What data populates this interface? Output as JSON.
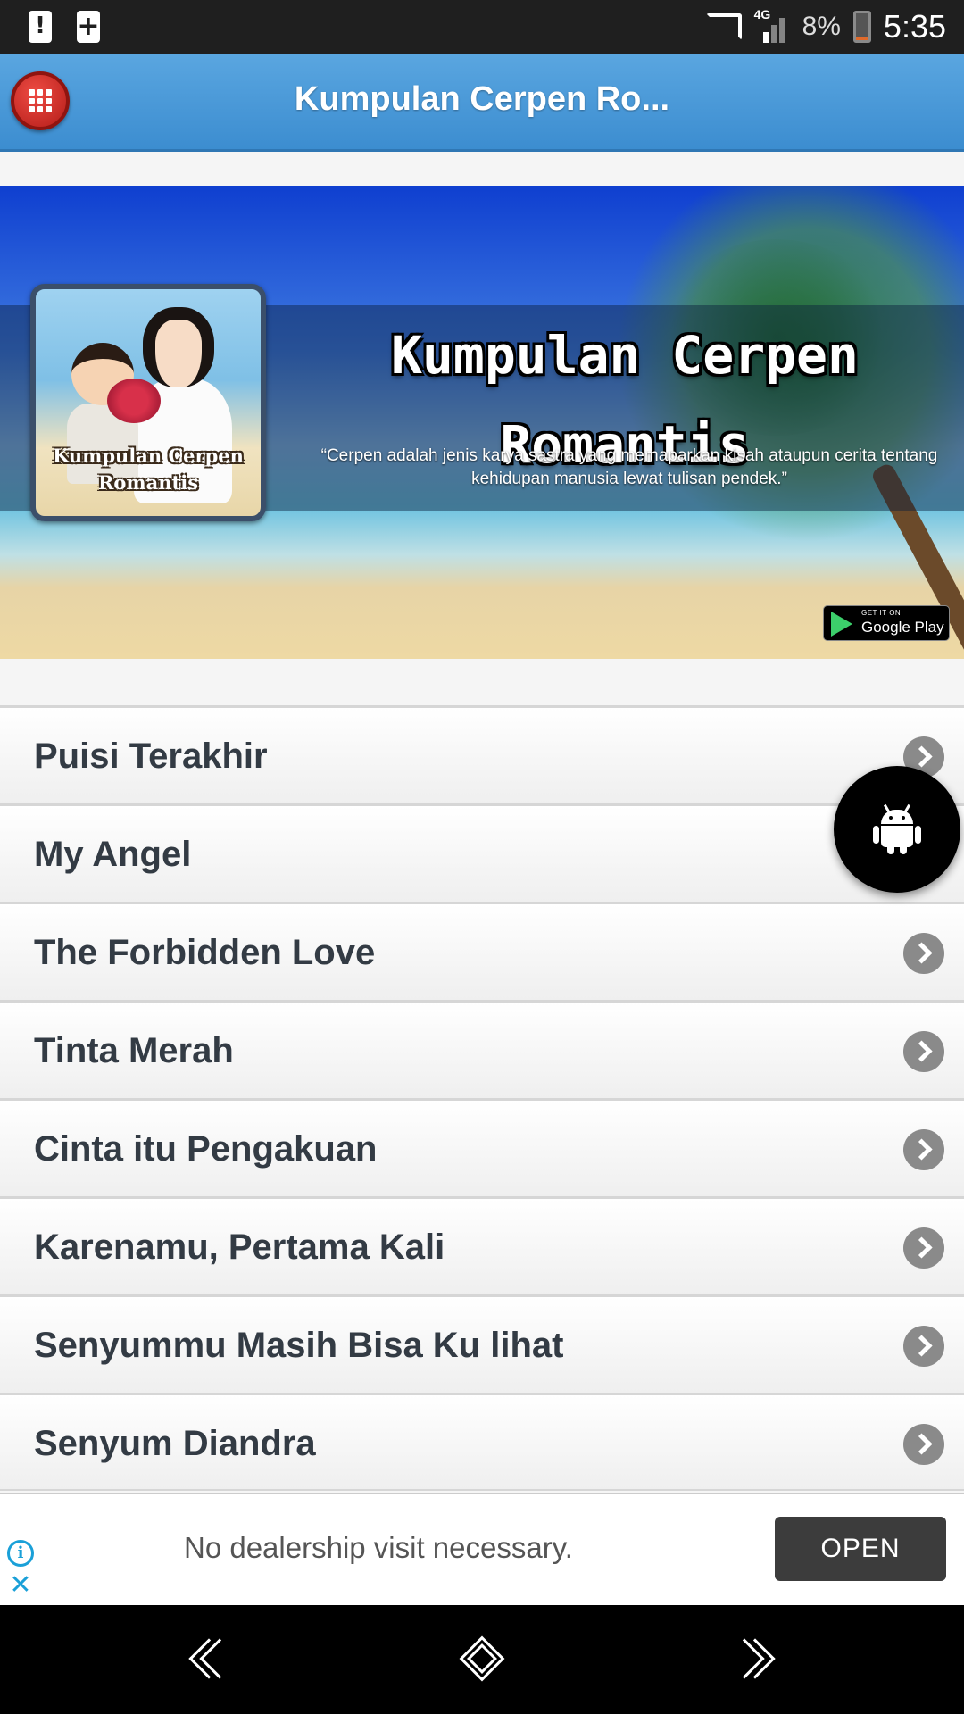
{
  "status_bar": {
    "battery_percent": "8%",
    "battery_level": 0.08,
    "network_label": "4G",
    "time": "5:35",
    "icons": [
      "alert-icon",
      "add-notification-icon",
      "cast-icon",
      "signal-icon",
      "battery-icon"
    ]
  },
  "app_bar": {
    "title": "Kumpulan Cerpen Ro...",
    "menu_icon": "grid-menu-icon",
    "accent_color": "#3c8dd0",
    "menu_button_color": "#d32f2f"
  },
  "banner": {
    "thumbnail_text": "Kumpulan Cerpen Romantis",
    "title_line1": "Kumpulan Cerpen",
    "title_line2": "Romantis",
    "quote": "“Cerpen adalah jenis karya sastra yang memaparkan kisah ataupun cerita tentang kehidupan manusia lewat tulisan pendek.”",
    "store_badge_small": "GET IT ON",
    "store_badge_big": "Google Play"
  },
  "list": {
    "items": [
      {
        "label": "Puisi Terakhir"
      },
      {
        "label": "My Angel"
      },
      {
        "label": "The Forbidden Love"
      },
      {
        "label": "Tinta Merah"
      },
      {
        "label": "Cinta itu Pengakuan"
      },
      {
        "label": "Karenamu, Pertama Kali"
      },
      {
        "label": "Senyummu Masih Bisa Ku lihat"
      },
      {
        "label": "Senyum Diandra"
      }
    ]
  },
  "fab": {
    "icon": "android-icon"
  },
  "ad": {
    "text": "No dealership visit necessary.",
    "button_label": "OPEN",
    "info_icon": "info-icon",
    "close_icon": "close-icon"
  },
  "nav_bar": {
    "icons": [
      "back-icon",
      "home-icon",
      "forward-icon"
    ]
  }
}
